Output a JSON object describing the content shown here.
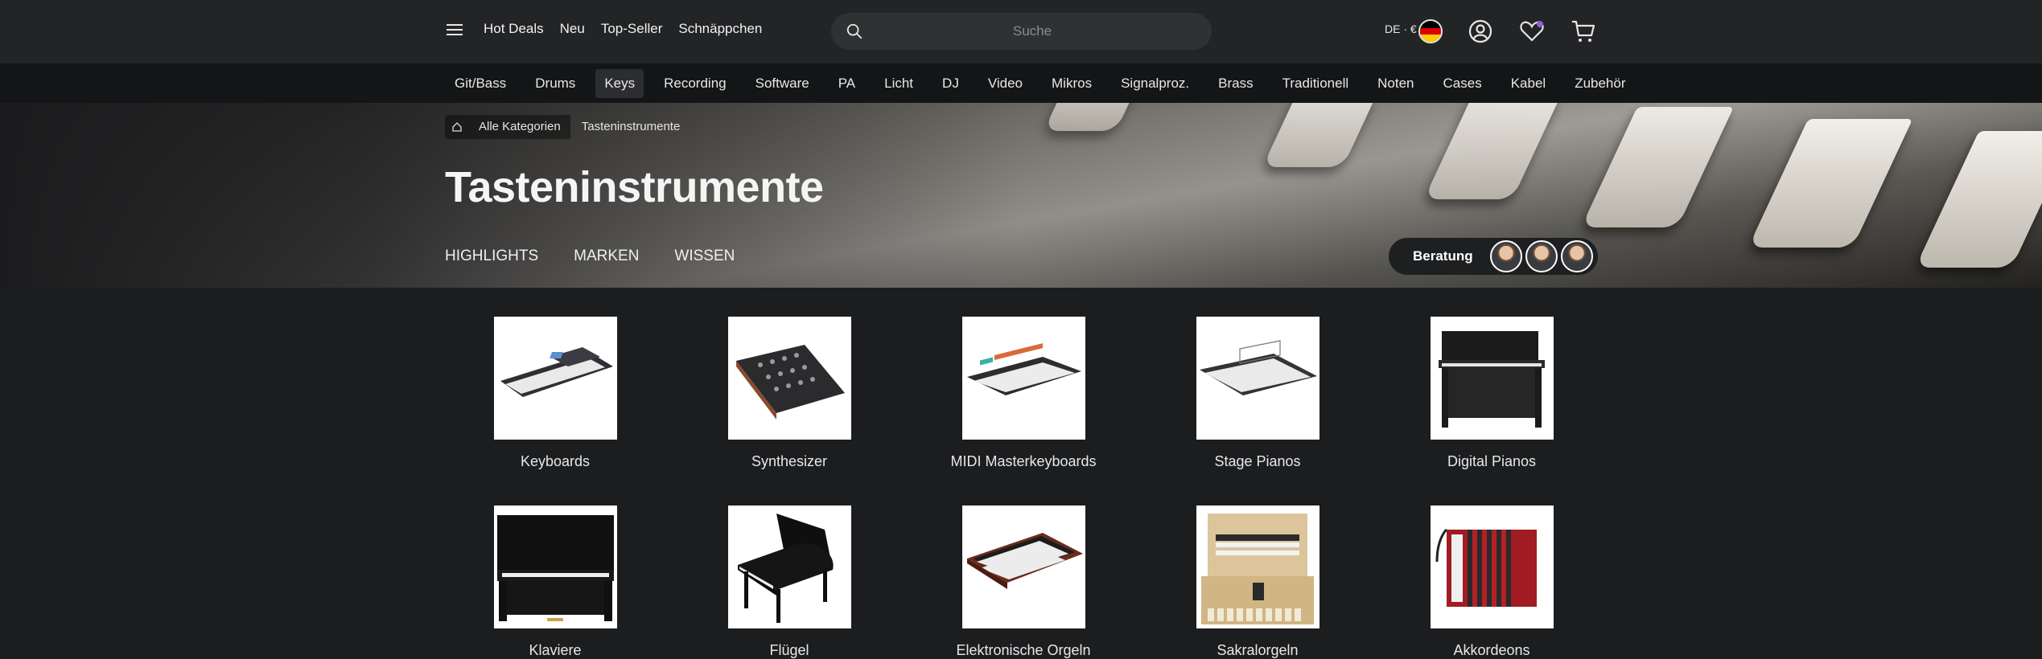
{
  "header": {
    "quick_links": [
      "Hot Deals",
      "Neu",
      "Top-Seller",
      "Schnäppchen"
    ],
    "search_placeholder": "Suche",
    "locale": "DE · €"
  },
  "category_nav": {
    "items": [
      "Git/Bass",
      "Drums",
      "Keys",
      "Recording",
      "Software",
      "PA",
      "Licht",
      "DJ",
      "Video",
      "Mikros",
      "Signalproz.",
      "Brass",
      "Traditionell",
      "Noten",
      "Cases",
      "Kabel",
      "Zubehör"
    ],
    "active": "Keys"
  },
  "breadcrumb": {
    "items": [
      "Alle Kategorien"
    ],
    "current": "Tasteninstrumente"
  },
  "hero": {
    "title": "Tasteninstrumente",
    "tabs": [
      "HIGHLIGHTS",
      "MARKEN",
      "WISSEN"
    ],
    "advice_label": "Beratung"
  },
  "categories": [
    {
      "label": "Keyboards",
      "icon": "keyboard-image"
    },
    {
      "label": "Synthesizer",
      "icon": "synthesizer-image"
    },
    {
      "label": "MIDI Masterkeyboards",
      "icon": "midi-keyboard-image"
    },
    {
      "label": "Stage Pianos",
      "icon": "stage-piano-image"
    },
    {
      "label": "Digital Pianos",
      "icon": "digital-piano-image"
    },
    {
      "label": "Klaviere",
      "icon": "upright-piano-image"
    },
    {
      "label": "Flügel",
      "icon": "grand-piano-image"
    },
    {
      "label": "Elektronische Orgeln",
      "icon": "electronic-organ-image"
    },
    {
      "label": "Sakralorgeln",
      "icon": "church-organ-image"
    },
    {
      "label": "Akkordeons",
      "icon": "accordion-image"
    }
  ],
  "colors": {
    "header_bg": "#232426",
    "nav_bg": "#141516",
    "page_bg": "#1c1d1f",
    "accent_heart": "#8a63d2"
  }
}
